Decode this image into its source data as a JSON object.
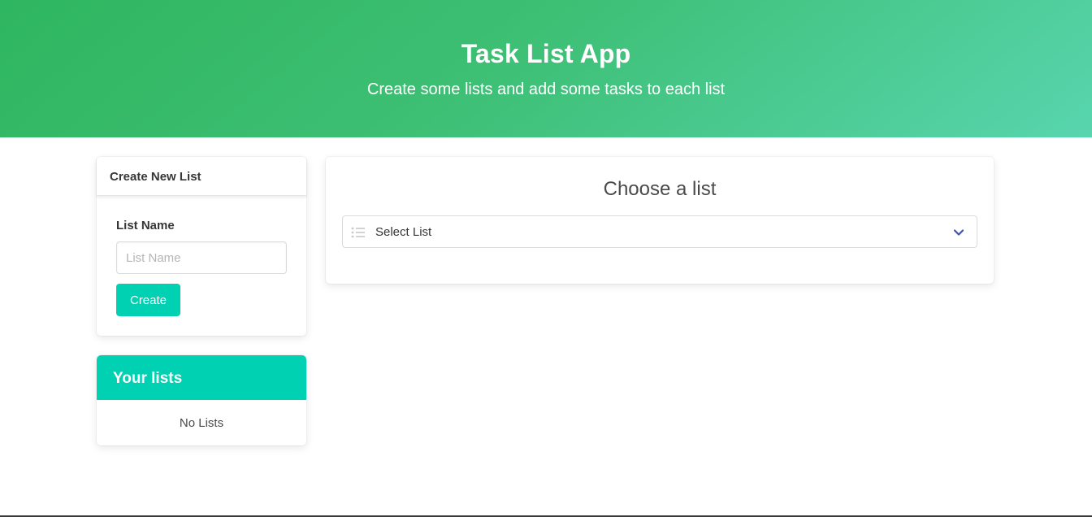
{
  "hero": {
    "title": "Task List App",
    "subtitle": "Create some lists and add some tasks to each list"
  },
  "create_list": {
    "header": "Create New List",
    "field_label": "List Name",
    "input_placeholder": "List Name",
    "input_value": "",
    "button_label": "Create"
  },
  "your_lists": {
    "header": "Your lists",
    "empty_text": "No Lists"
  },
  "chooser": {
    "title": "Choose a list",
    "select_value": "Select List",
    "select_icon": "list-icon",
    "dropdown_icon": "chevron-down-icon"
  },
  "colors": {
    "hero_gradient_start": "#2fb65f",
    "hero_gradient_end": "#58d5ae",
    "primary": "#00d1b2",
    "chevron": "#3f51b5"
  }
}
